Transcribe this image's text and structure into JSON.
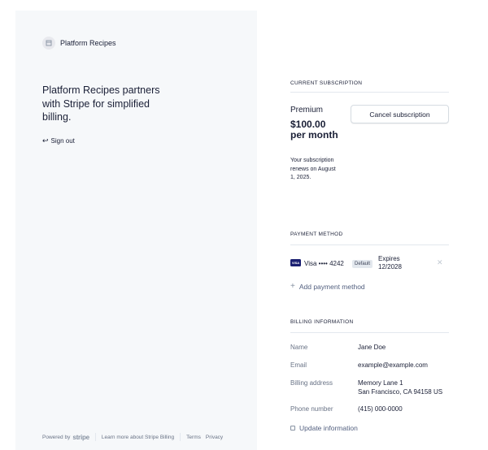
{
  "brand": {
    "name": "Platform Recipes",
    "icon": "store-icon"
  },
  "headline": "Platform Recipes partners with Stripe for simplified billing.",
  "signout": {
    "icon": "arrow-left-icon",
    "label": "Sign out"
  },
  "footer": {
    "powered_by": "Powered by",
    "stripe": "stripe",
    "learn_more": "Learn more about Stripe Billing",
    "terms": "Terms",
    "privacy": "Privacy"
  },
  "subscription": {
    "title": "CURRENT SUBSCRIPTION",
    "plan": "Premium",
    "price": "$100.00 per month",
    "renews": "Your subscription renews on August 1, 2025.",
    "cancel_label": "Cancel subscription"
  },
  "payment": {
    "title": "PAYMENT METHOD",
    "card_brand_icon": "VISA",
    "card_label": "Visa •••• 4242",
    "default_badge": "Default",
    "expires_line1": "Expires",
    "expires_line2": "12/2028",
    "add_label": "Add payment method"
  },
  "billing": {
    "title": "BILLING INFORMATION",
    "name_label": "Name",
    "name_value": "Jane Doe",
    "email_label": "Email",
    "email_value": "example@example.com",
    "address_label": "Billing address",
    "address_line1": "Memory Lane 1",
    "address_line2": "San Francisco, CA 94158 US",
    "phone_label": "Phone number",
    "phone_value": "(415) 000-0000",
    "update_label": "Update information"
  },
  "colors": {
    "panel_bg": "#f6f8fa",
    "text": "#1a1f36",
    "muted": "#697386",
    "visa": "#1a1f71"
  }
}
